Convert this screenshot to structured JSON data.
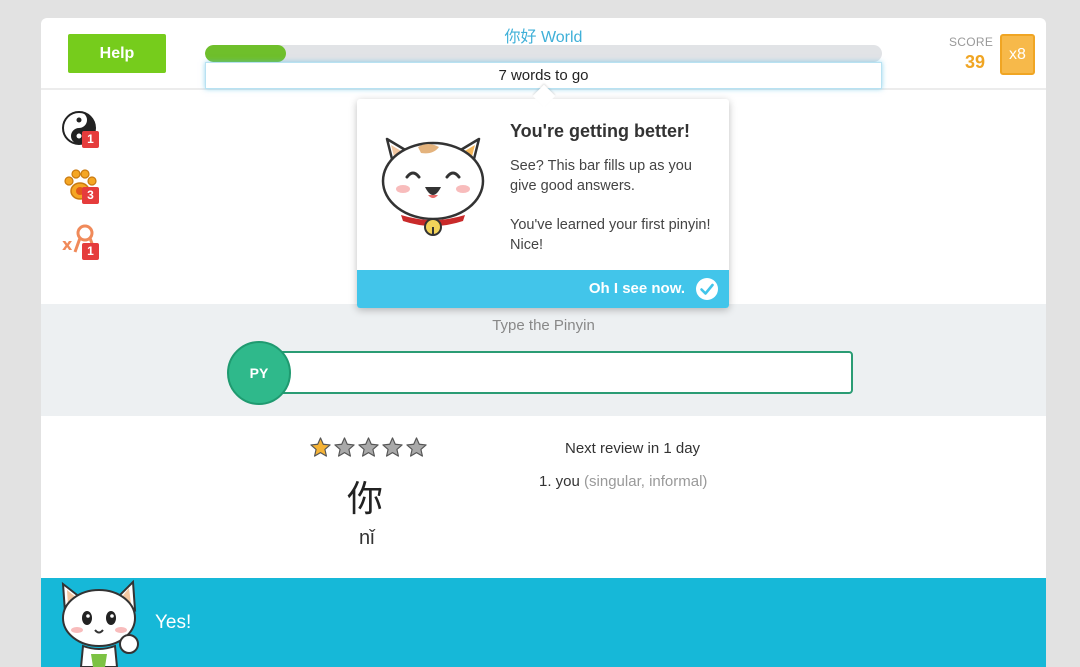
{
  "header": {
    "help_label": "Help",
    "course_title": "你好 World",
    "progress_fraction": 0.12,
    "progress_text": "7 words to go",
    "score_label": "SCORE",
    "score_value": "39",
    "multiplier": "x8"
  },
  "stats": [
    {
      "icon": "yin-yang-icon",
      "count": "1"
    },
    {
      "icon": "paw-icon",
      "count": "3"
    },
    {
      "icon": "mistake-icon",
      "count": "1"
    }
  ],
  "tooltip": {
    "title": "You're getting better!",
    "paragraph1": "See? This bar fills up as you give good answers.",
    "paragraph2": "You've learned your first pinyin! Nice!",
    "button_label": "Oh I see now."
  },
  "quiz": {
    "prompt": "Type the Pinyin",
    "input_badge": "PY",
    "input_value": ""
  },
  "word": {
    "stars_filled": 1,
    "stars_total": 5,
    "hanzi": "你",
    "pinyin": "nǐ",
    "next_review": "Next review in 1 day",
    "definition_main": "1. you",
    "definition_note": "(singular, informal)"
  },
  "feedback": {
    "text": "Yes!"
  },
  "colors": {
    "accent_blue": "#42c5ea",
    "feedback_bar": "#16b8d8",
    "help_green": "#76cc1c",
    "progress_green": "#6fbf2b",
    "score_orange": "#f0a523",
    "input_border": "#2a9c74"
  }
}
